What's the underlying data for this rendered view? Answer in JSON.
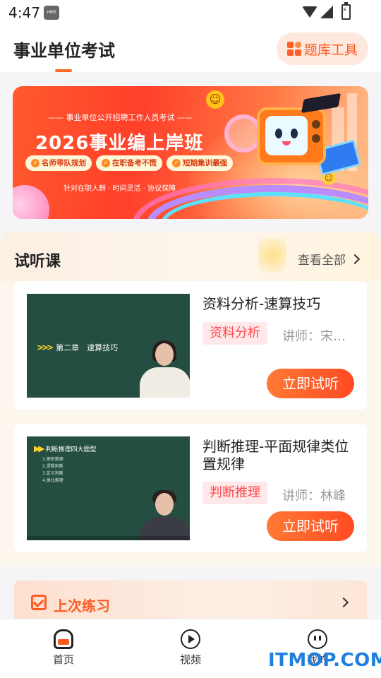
{
  "status_bar": {
    "time": "4:47",
    "hms_badge": "HMS"
  },
  "header": {
    "title": "事业单位考试",
    "tool_button": {
      "label": "题库工具",
      "icon": "grid-icon"
    }
  },
  "banner": {
    "subtitle": "—— 事业单位公开招聘工作人员考试 ——",
    "title": "2026事业编上岸班",
    "tags": [
      "名师带队规划",
      "在职备考不慌",
      "短期集训最强"
    ],
    "footer": "针对在职人群 · 时间灵活 · 协议保障"
  },
  "trial_section": {
    "title": "试听课",
    "view_all": "查看全部",
    "courses": [
      {
        "title": "资料分析-速算技巧",
        "subject": "资料分析",
        "teacher": "讲师：宋明...",
        "button": "立即试听",
        "thumb_heading": "第二章　速算技巧"
      },
      {
        "title": "判断推理-平面规律类位置规律",
        "subject": "判断推理",
        "teacher": "讲师：林峰",
        "button": "立即试听",
        "thumb_heading": "判断推理四大题型",
        "thumb_list": [
          "1.图形推理",
          "2.逻辑判断",
          "3.定义判断",
          "4.类比推理"
        ]
      }
    ]
  },
  "last_practice": {
    "title": "上次练习"
  },
  "bottom_nav": {
    "items": [
      {
        "label": "首页",
        "icon": "home-icon",
        "active": true
      },
      {
        "label": "视频",
        "icon": "play-icon",
        "active": false
      },
      {
        "label": "我的",
        "icon": "me-icon",
        "active": false
      }
    ]
  },
  "watermark": "ITMOP.COM",
  "colors": {
    "accent": "#ff5a1f",
    "trial_button": "#ff4a22",
    "tag_bg": "#ffe8ea",
    "watermark": "#1e7fe0"
  }
}
